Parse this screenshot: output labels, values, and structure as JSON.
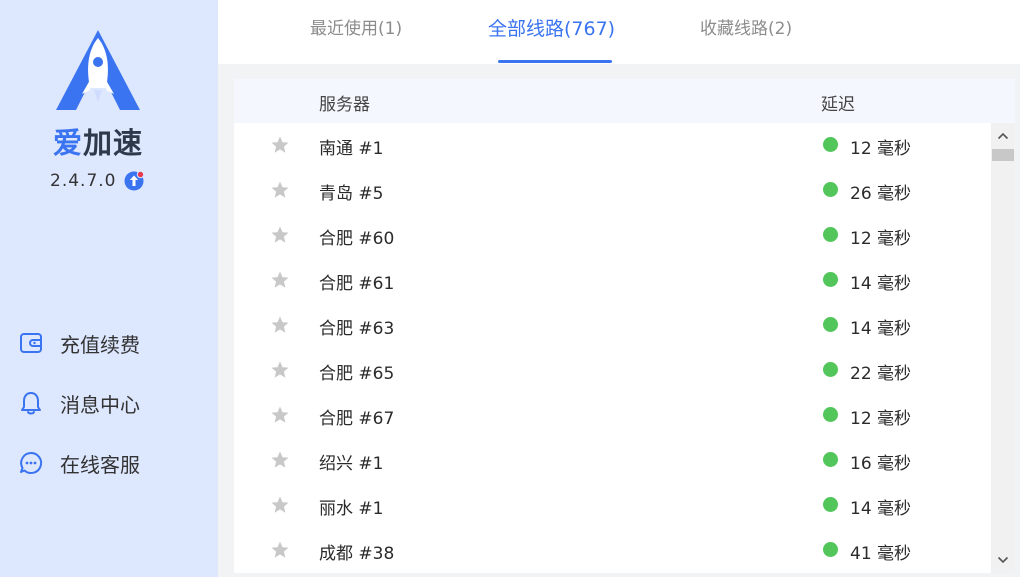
{
  "app": {
    "brand": [
      "爱",
      "加速"
    ],
    "version": "2.4.7.0"
  },
  "colors": {
    "accent": "#3a74f0",
    "sidebar_bg": "#dde7fe",
    "latency_good": "#52c65a",
    "star_inactive": "#c8c8c8",
    "update_badge": "#e8384f"
  },
  "sidebar": {
    "items": [
      {
        "label": "充值续费",
        "icon": "wallet-icon"
      },
      {
        "label": "消息中心",
        "icon": "bell-icon"
      },
      {
        "label": "在线客服",
        "icon": "chat-icon"
      }
    ]
  },
  "tabs": [
    {
      "label": "最近使用(1)",
      "active": false
    },
    {
      "label": "全部线路(767)",
      "active": true
    },
    {
      "label": "收藏线路(2)",
      "active": false
    }
  ],
  "table": {
    "headers": {
      "server": "服务器",
      "latency": "延迟"
    },
    "rows": [
      {
        "server": "南通 #1",
        "latency": "12 毫秒"
      },
      {
        "server": "青岛 #5",
        "latency": "26 毫秒"
      },
      {
        "server": "合肥 #60",
        "latency": "12 毫秒"
      },
      {
        "server": "合肥 #61",
        "latency": "14 毫秒"
      },
      {
        "server": "合肥 #63",
        "latency": "14 毫秒"
      },
      {
        "server": "合肥 #65",
        "latency": "22 毫秒"
      },
      {
        "server": "合肥 #67",
        "latency": "12 毫秒"
      },
      {
        "server": "绍兴 #1",
        "latency": "16 毫秒"
      },
      {
        "server": "丽水 #1",
        "latency": "14 毫秒"
      },
      {
        "server": "成都 #38",
        "latency": "41 毫秒"
      }
    ]
  }
}
